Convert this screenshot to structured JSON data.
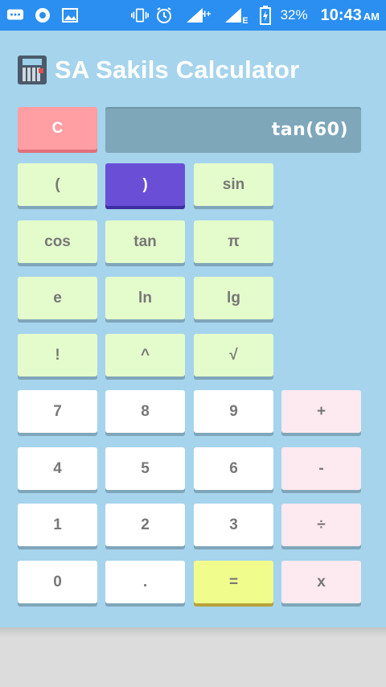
{
  "status_bar": {
    "battery_percent": "32%",
    "time": "10:43",
    "ampm": "AM",
    "network_type_1": "H+",
    "network_type_2": "E"
  },
  "app": {
    "title": "SA Sakils Calculator"
  },
  "display": {
    "expression": "tan(60)"
  },
  "buttons": {
    "clear": "C",
    "open_paren": "(",
    "close_paren": ")",
    "sin": "sin",
    "cos": "cos",
    "tan": "tan",
    "pi": "π",
    "e": "e",
    "ln": "ln",
    "lg": "lg",
    "factorial": "!",
    "power": "^",
    "sqrt": "√",
    "n7": "7",
    "n8": "8",
    "n9": "9",
    "plus": "+",
    "n4": "4",
    "n5": "5",
    "n6": "6",
    "minus": "-",
    "n1": "1",
    "n2": "2",
    "n3": "3",
    "divide": "÷",
    "n0": "0",
    "dot": ".",
    "equals": "=",
    "multiply": "x"
  },
  "colors": {
    "status_bar": "#2a8ff0",
    "app_background": "#a6d4ec",
    "display_background": "#7ea7ba",
    "function_key": "#e4fccc",
    "digit_key": "#ffffff",
    "operator_key": "#fde9f0",
    "equals_key": "#f0fc8c",
    "clear_key": "#ff9ea3",
    "active_key": "#6a4fd6"
  }
}
